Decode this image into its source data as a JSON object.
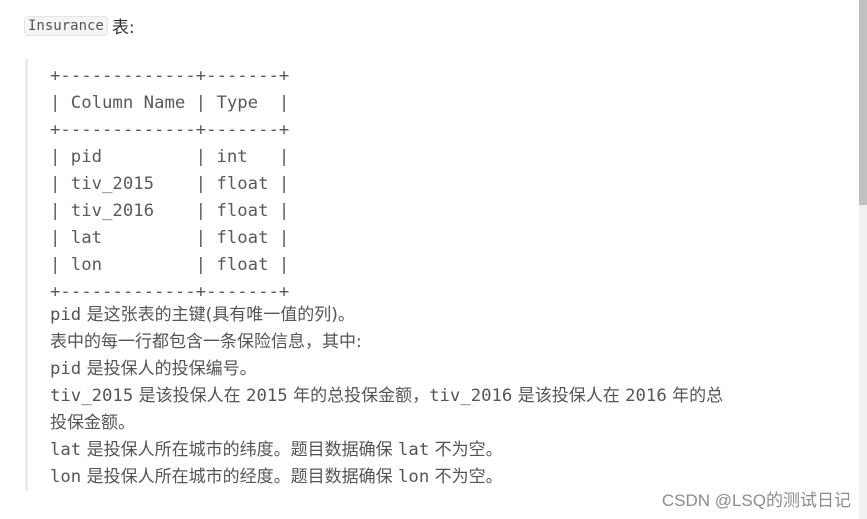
{
  "intro": {
    "table_name": "Insurance",
    "suffix": "表:"
  },
  "schema_table": {
    "border_line": "+-------------+-------+",
    "header": {
      "column_name": "Column Name",
      "type": "Type"
    },
    "rows": [
      {
        "column_name": "pid",
        "type": "int"
      },
      {
        "column_name": "tiv_2015",
        "type": "float"
      },
      {
        "column_name": "tiv_2016",
        "type": "float"
      },
      {
        "column_name": "lat",
        "type": "float"
      },
      {
        "column_name": "lon",
        "type": "float"
      }
    ]
  },
  "description": {
    "line1": {
      "code": "pid",
      "text": " 是这张表的主键(具有唯一值的列)。"
    },
    "line2": {
      "text": "表中的每一行都包含一条保险信息，其中:"
    },
    "line3": {
      "code": "pid",
      "text": " 是投保人的投保编号。"
    },
    "line4": {
      "code1": "tiv_2015",
      "text1": " 是该投保人在 ",
      "year1": "2015",
      "text2": " 年的总投保金额，",
      "code2": "tiv_2016",
      "text3": " 是该投保人在 ",
      "year2": "2016",
      "text4": " 年的总"
    },
    "line5": {
      "text": "投保金额。"
    },
    "line6": {
      "code1": "lat",
      "text1": " 是投保人所在城市的纬度。题目数据确保 ",
      "code2": "lat",
      "text2": " 不为空。"
    },
    "line7": {
      "code1": "lon",
      "text1": " 是投保人所在城市的经度。题目数据确保 ",
      "code2": "lon",
      "text2": " 不为空。"
    }
  },
  "watermark": "CSDN @LSQ的测试日记"
}
